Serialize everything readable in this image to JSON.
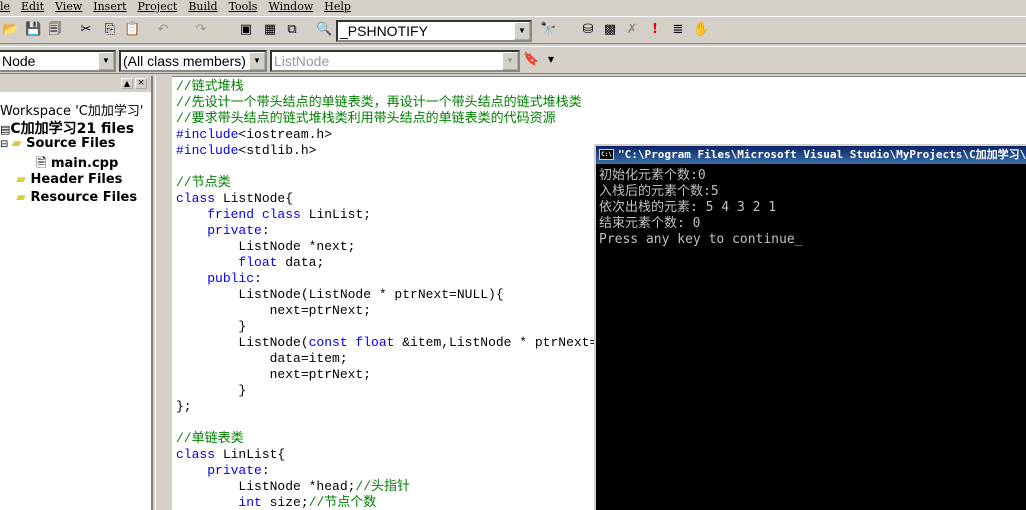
{
  "menu": [
    "le",
    "Edit",
    "View",
    "Insert",
    "Project",
    "Build",
    "Tools",
    "Window",
    "Help"
  ],
  "toolbar": {
    "find_combo": "_PSHNOTIFY",
    "class_combo": "Node",
    "members_combo": "(All class members)",
    "function_combo": "ListNode"
  },
  "workspace": {
    "title": "Workspace 'C加加学习'",
    "project": "C加加学习21 files",
    "items": [
      "Source Files",
      "main.cpp",
      "Header Files",
      "Resource Files"
    ]
  },
  "code": [
    [
      [
        "cm",
        "//链式堆栈"
      ]
    ],
    [
      [
        "cm",
        "//先设计一个带头结点的单链表类，再设计一个带头结点的链式堆栈类"
      ]
    ],
    [
      [
        "cm",
        "//要求带头结点的链式堆栈类利用带头结点的单链表类的代码资源"
      ]
    ],
    [
      [
        "kw",
        "#include"
      ],
      [
        "",
        "<iostream.h>"
      ]
    ],
    [
      [
        "kw",
        "#include"
      ],
      [
        "",
        "<stdlib.h>"
      ]
    ],
    [],
    [
      [
        "cm",
        "//节点类"
      ]
    ],
    [
      [
        "kw",
        "class"
      ],
      [
        "",
        " ListNode{"
      ]
    ],
    [
      [
        "",
        "    "
      ],
      [
        "kw",
        "friend class"
      ],
      [
        "",
        " LinList;"
      ]
    ],
    [
      [
        "",
        "    "
      ],
      [
        "kw",
        "private"
      ],
      [
        "",
        ":"
      ]
    ],
    [
      [
        "",
        "        ListNode *next;"
      ]
    ],
    [
      [
        "",
        "        "
      ],
      [
        "kw",
        "float"
      ],
      [
        "",
        " data;"
      ]
    ],
    [
      [
        "",
        "    "
      ],
      [
        "kw",
        "public"
      ],
      [
        "",
        ":"
      ]
    ],
    [
      [
        "",
        "        ListNode(ListNode * ptrNext=NULL){"
      ]
    ],
    [
      [
        "",
        "            next=ptrNext;"
      ]
    ],
    [
      [
        "",
        "        }"
      ]
    ],
    [
      [
        "",
        "        ListNode("
      ],
      [
        "kw",
        "const float"
      ],
      [
        "",
        " &item,ListNode * ptrNext=NULL){"
      ]
    ],
    [
      [
        "",
        "            data=item;"
      ]
    ],
    [
      [
        "",
        "            next=ptrNext;"
      ]
    ],
    [
      [
        "",
        "        }"
      ]
    ],
    [
      [
        "",
        "};"
      ]
    ],
    [],
    [
      [
        "cm",
        "//单链表类"
      ]
    ],
    [
      [
        "kw",
        "class"
      ],
      [
        "",
        " LinList{"
      ]
    ],
    [
      [
        "",
        "    "
      ],
      [
        "kw",
        "private"
      ],
      [
        "",
        ":"
      ]
    ],
    [
      [
        "",
        "        ListNode *head;"
      ],
      [
        "cm",
        "//头指针"
      ]
    ],
    [
      [
        "",
        "        "
      ],
      [
        "kw",
        "int"
      ],
      [
        "",
        " size;"
      ],
      [
        "cm",
        "//节点个数"
      ]
    ]
  ],
  "console": {
    "title": "\"C:\\Program Files\\Microsoft Visual Studio\\MyProjects\\C加加学习\\Debug\\main.exe\"",
    "lines": [
      "初始化元素个数:0",
      "入栈后的元素个数:5",
      "依次出栈的元素: 5 4 3 2 1",
      "结束元素个数: 0",
      "Press any key to continue_"
    ]
  }
}
